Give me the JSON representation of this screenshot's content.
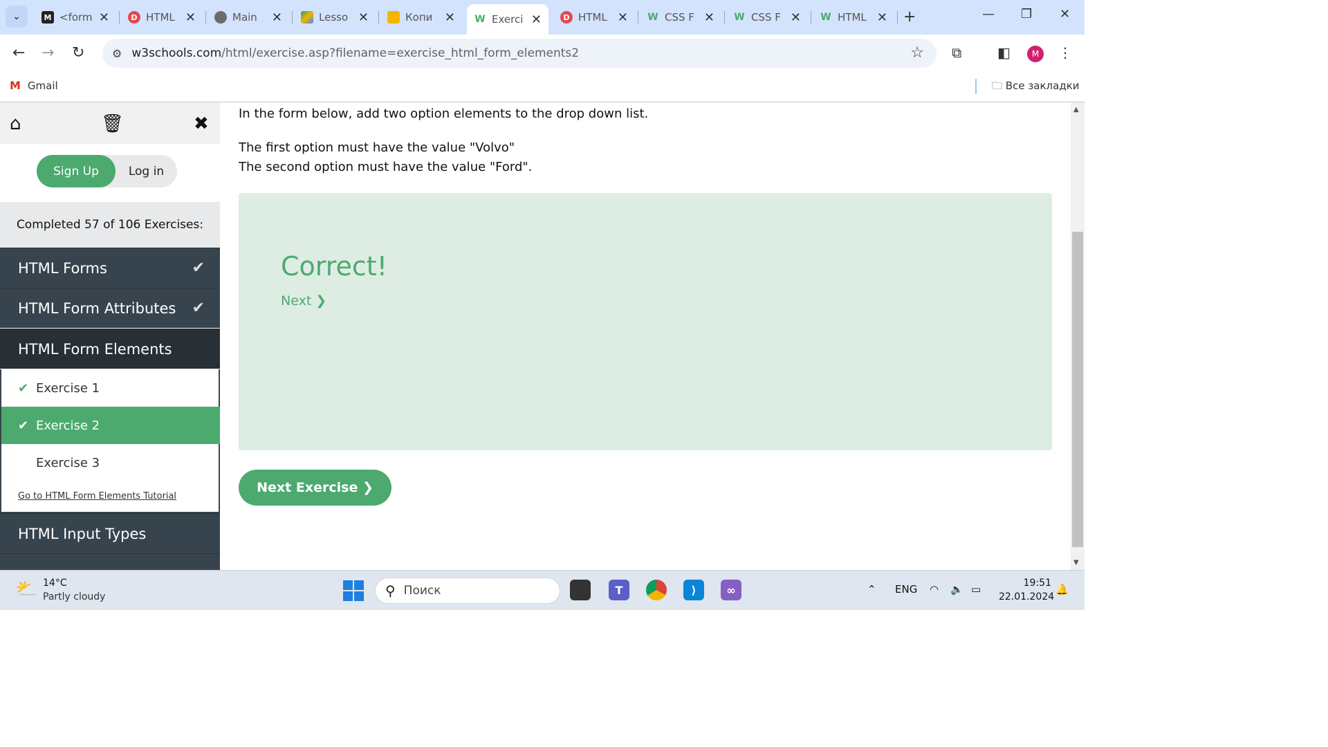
{
  "browser": {
    "tabs": [
      {
        "title": "<form",
        "fav_color": "#222222",
        "fav_text": "M"
      },
      {
        "title": "HTML",
        "fav_color": "#e5484d",
        "fav_text": "D"
      },
      {
        "title": "Main",
        "fav_color": "#6b6b6b",
        "fav_text": "◎"
      },
      {
        "title": "Lesso",
        "fav_color": "#1fa463",
        "fav_text": "▲"
      },
      {
        "title": "Копи",
        "fav_color": "#f4b400",
        "fav_text": "▬"
      },
      {
        "title": "Exerci",
        "fav_color": "#4caa6e",
        "fav_text": "W"
      },
      {
        "title": "HTML",
        "fav_color": "#e5484d",
        "fav_text": "D"
      },
      {
        "title": "CSS F",
        "fav_color": "#4caa6e",
        "fav_text": "W"
      },
      {
        "title": "CSS F",
        "fav_color": "#4caa6e",
        "fav_text": "W"
      },
      {
        "title": "HTML",
        "fav_color": "#4caa6e",
        "fav_text": "W"
      }
    ],
    "active_tab_index": 5,
    "url_host": "w3schools.com",
    "url_path": "/html/exercise.asp?filename=exercise_html_form_elements2",
    "avatar_letter": "M",
    "bookmark_gmail": "Gmail",
    "bookmarks_all": "Все закладки"
  },
  "sidebar": {
    "signup": "Sign Up",
    "login": "Log in",
    "progress_text": "Completed 57 of 106 Exercises:",
    "sections": [
      {
        "label": "HTML Forms",
        "done": true
      },
      {
        "label": "HTML Form Attributes",
        "done": true
      },
      {
        "label": "HTML Form Elements",
        "done": false
      }
    ],
    "exercises": [
      {
        "label": "Exercise 1",
        "done": true
      },
      {
        "label": "Exercise 2",
        "done": true
      },
      {
        "label": "Exercise 3",
        "done": false
      }
    ],
    "tutorial_link": "Go to HTML Form Elements Tutorial",
    "next_section": "HTML Input Types"
  },
  "main": {
    "instruction_1": "In the form below, add two option elements to the drop down list.",
    "instruction_2": "The first option must have the value \"Volvo\"",
    "instruction_3": "The second option must have the value \"Ford\".",
    "result_title": "Correct!",
    "next_link": "Next ❯",
    "next_exercise": "Next Exercise ❯"
  },
  "taskbar": {
    "temperature": "14°C",
    "weather": "Partly cloudy",
    "search_placeholder": "Поиск",
    "lang": "ENG",
    "time": "19:51",
    "date": "22.01.2024"
  }
}
